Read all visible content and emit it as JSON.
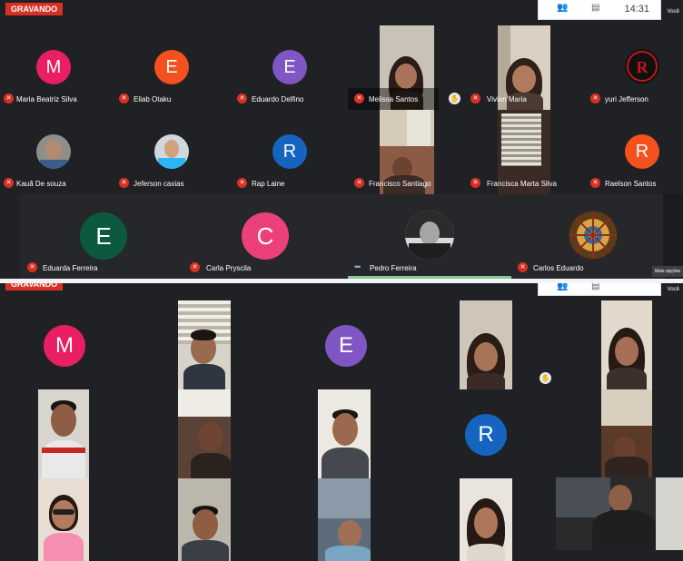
{
  "top": {
    "recording_label": "GRAVANDO",
    "clock": "14:31",
    "self_label": "Você",
    "more_options": "Mais opções",
    "participants": {
      "maria_beatriz": {
        "initial": "M",
        "name": "Maria Beatriz Silva",
        "color": "#e91e63"
      },
      "eliab": {
        "initial": "E",
        "name": "Eliab Otaku",
        "color": "#f4511e"
      },
      "eduardo_delfino": {
        "initial": "E",
        "name": "Eduardo Delfino",
        "color": "#7e57c2"
      },
      "melissa": {
        "name": "Melissa Santos"
      },
      "vivian": {
        "name": "Vivian Maria"
      },
      "yuri": {
        "name": "yuri Jefferson"
      },
      "kaua": {
        "name": "Kauã De souza"
      },
      "jeferson": {
        "name": "Jeferson caxias"
      },
      "rap_laine": {
        "initial": "R",
        "name": "Rap Laine",
        "color": "#1565c0"
      },
      "francisco": {
        "name": "Francisco Santiago"
      },
      "francisca": {
        "name": "Francisca Marta Silva"
      },
      "raelson": {
        "initial": "R",
        "name": "Raelson Santos",
        "color": "#f4511e"
      },
      "eduarda": {
        "initial": "E",
        "name": "Eduarda Ferreira",
        "color": "#0b5a3d"
      },
      "carla": {
        "initial": "C",
        "name": "Carla Pryscila",
        "color": "#ec407a"
      },
      "pedro": {
        "name": "Pedro Ferreira"
      },
      "carlos": {
        "name": "Carlos Eduardo"
      }
    }
  },
  "bottom": {
    "recording_label": "GRAVANDO",
    "self_label": "Você",
    "tiles": {
      "m": {
        "initial": "M",
        "color": "#e91e63"
      },
      "e": {
        "initial": "E",
        "color": "#7e57c2"
      },
      "r": {
        "initial": "R",
        "color": "#1565c0"
      }
    }
  },
  "icons": {
    "mic_off": "mic-off-icon",
    "raise_hand": "hand-icon"
  }
}
